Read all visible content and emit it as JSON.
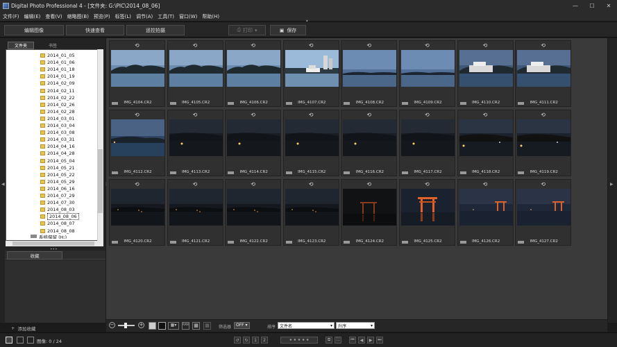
{
  "window": {
    "title": "Digital Photo Professional 4 - [文件夹: G:\\PIC\\2014_08_06]",
    "min_label": "—",
    "max_label": "☐",
    "close_label": "✕"
  },
  "menu": [
    "文件(F)",
    "编辑(E)",
    "查看(V)",
    "缩略图(B)",
    "预览(P)",
    "标签(L)",
    "调节(A)",
    "工具(T)",
    "窗口(W)",
    "帮助(H)"
  ],
  "toolbar": {
    "edit_image": "编辑图像",
    "quick_check": "快速查看",
    "remote_shoot": "遥控拍摄",
    "print": "打印",
    "save": "保存"
  },
  "panel": {
    "folders_tab": "文件夹",
    "bookmarks_tab": "书签",
    "favorites_tab": "收藏",
    "add_favorite": "添加收藏"
  },
  "tree": {
    "folders": [
      "2014_01_05",
      "2014_01_06",
      "2014_01_18",
      "2014_01_19",
      "2014_02_09",
      "2014_02_11",
      "2014_02_22",
      "2014_02_26",
      "2014_02_28",
      "2014_03_01",
      "2014_03_04",
      "2014_03_08",
      "2014_03_31",
      "2014_04_16",
      "2014_04_28",
      "2014_05_04",
      "2014_05_21",
      "2014_05_22",
      "2014_05_29",
      "2014_06_16",
      "2014_07_29",
      "2014_07_30",
      "2014_08_03",
      "2014_08_06",
      "2014_08_07",
      "2014_08_08"
    ],
    "selected": "2014_08_06",
    "system_reserved": "系统保留 (H:)"
  },
  "thumbnails": [
    {
      "name": "IMG_4104.CR2",
      "scene": "day-sea"
    },
    {
      "name": "IMG_4105.CR2",
      "scene": "day-sea"
    },
    {
      "name": "IMG_4106.CR2",
      "scene": "day-sea"
    },
    {
      "name": "IMG_4107.CR2",
      "scene": "day-boats"
    },
    {
      "name": "IMG_4108.CR2",
      "scene": "dusk-sky"
    },
    {
      "name": "IMG_4109.CR2",
      "scene": "dusk-sky"
    },
    {
      "name": "IMG_4110.CR2",
      "scene": "ferry"
    },
    {
      "name": "IMG_4111.CR2",
      "scene": "ferry"
    },
    {
      "name": "IMG_4112.CR2",
      "scene": "dusk-shore"
    },
    {
      "name": "IMG_4113.CR2",
      "scene": "night-dark"
    },
    {
      "name": "IMG_4114.CR2",
      "scene": "night-dark"
    },
    {
      "name": "IMG_4115.CR2",
      "scene": "night-dark"
    },
    {
      "name": "IMG_4116.CR2",
      "scene": "night-dark"
    },
    {
      "name": "IMG_4117.CR2",
      "scene": "night-dark"
    },
    {
      "name": "IMG_4118.CR2",
      "scene": "night-lights"
    },
    {
      "name": "IMG_4119.CR2",
      "scene": "night-lights"
    },
    {
      "name": "IMG_4120.CR2",
      "scene": "night-shore"
    },
    {
      "name": "IMG_4121.CR2",
      "scene": "night-shore"
    },
    {
      "name": "IMG_4122.CR2",
      "scene": "night-shore"
    },
    {
      "name": "IMG_4123.CR2",
      "scene": "night-shore"
    },
    {
      "name": "IMG_4124.CR2",
      "scene": "torii-dark"
    },
    {
      "name": "IMG_4125.CR2",
      "scene": "torii-lit"
    },
    {
      "name": "IMG_4126.CR2",
      "scene": "torii-far"
    },
    {
      "name": "IMG_4127.CR2",
      "scene": "torii-far"
    }
  ],
  "bottom": {
    "filter_label": "筛选器",
    "filter_value": "OFF",
    "sort_label": "排序",
    "sort_value": "文件名",
    "order_value": "升序"
  },
  "status": {
    "image_count": "图像: 0 / 24"
  },
  "colors": {
    "background": "#1b1b1b",
    "grid_background": "#3a3a3a",
    "folder_icon": "#e8c350"
  }
}
